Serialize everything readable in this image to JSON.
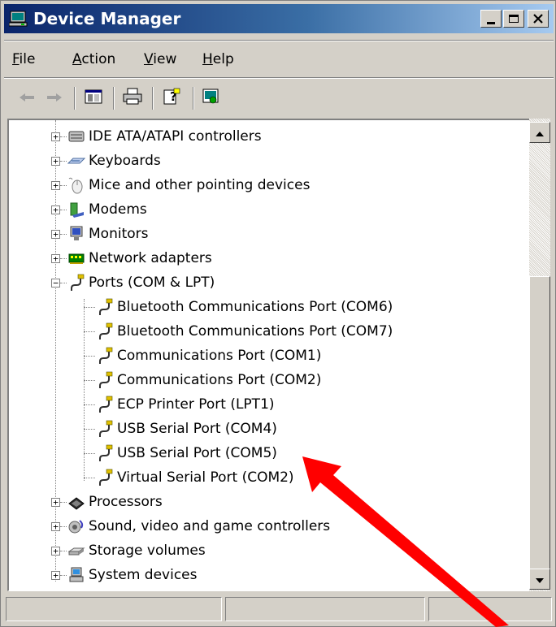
{
  "window": {
    "title": "Device Manager",
    "minimize": "_",
    "maximize": "□",
    "close": "×"
  },
  "menu": {
    "items": [
      {
        "mnemonic": "F",
        "rest": "ile"
      },
      {
        "mnemonic": "A",
        "rest": "ction"
      },
      {
        "mnemonic": "V",
        "rest": "iew"
      },
      {
        "mnemonic": "H",
        "rest": "elp"
      }
    ]
  },
  "toolbar": {
    "icons": [
      "back-arrow-icon",
      "forward-arrow-icon",
      "show-hide-console-tree-icon",
      "print-icon",
      "help-icon",
      "properties-icon"
    ]
  },
  "tree": {
    "categories": [
      {
        "label": "IDE ATA/ATAPI controllers",
        "icon": "ide-controller-icon"
      },
      {
        "label": "Keyboards",
        "icon": "keyboard-icon"
      },
      {
        "label": "Mice and other pointing devices",
        "icon": "mouse-icon"
      },
      {
        "label": "Modems",
        "icon": "modem-icon"
      },
      {
        "label": "Monitors",
        "icon": "monitor-icon"
      },
      {
        "label": "Network adapters",
        "icon": "network-adapter-icon"
      },
      {
        "label": "Ports (COM & LPT)",
        "icon": "port-connector-icon"
      }
    ],
    "ports": [
      "Bluetooth Communications Port (COM6)",
      "Bluetooth Communications Port (COM7)",
      "Communications Port (COM1)",
      "Communications Port (COM2)",
      "ECP Printer Port (LPT1)",
      "USB Serial Port (COM4)",
      "USB Serial Port (COM5)",
      "Virtual Serial Port (COM2)"
    ],
    "more_categories": [
      {
        "label": "Processors",
        "icon": "processor-icon"
      },
      {
        "label": "Sound, video and game controllers",
        "icon": "sound-icon"
      },
      {
        "label": "Storage volumes",
        "icon": "storage-volume-icon"
      },
      {
        "label": "System devices",
        "icon": "system-device-icon"
      }
    ]
  },
  "annotation": {
    "arrow_color": "#ff0000"
  },
  "colors": {
    "title_start": "#0a246a",
    "title_end": "#a6caf0",
    "face": "#d4d0c8"
  }
}
